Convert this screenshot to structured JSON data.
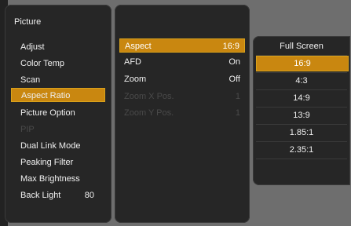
{
  "picture_menu": {
    "title": "Picture",
    "items": [
      {
        "label": "Adjust",
        "value": ""
      },
      {
        "label": "Color Temp",
        "value": ""
      },
      {
        "label": "Scan",
        "value": ""
      },
      {
        "label": "Aspect Ratio",
        "value": ""
      },
      {
        "label": "Picture Option",
        "value": ""
      },
      {
        "label": "PIP",
        "value": ""
      },
      {
        "label": "Dual Link Mode",
        "value": ""
      },
      {
        "label": "Peaking Filter",
        "value": ""
      },
      {
        "label": "Max Brightness",
        "value": ""
      },
      {
        "label": "Back Light",
        "value": "80"
      }
    ]
  },
  "aspect_menu": {
    "items": [
      {
        "label": "Aspect",
        "value": "16:9"
      },
      {
        "label": "AFD",
        "value": "On"
      },
      {
        "label": "Zoom",
        "value": "Off"
      },
      {
        "label": "Zoom X Pos.",
        "value": "1"
      },
      {
        "label": "Zoom Y Pos.",
        "value": "1"
      }
    ]
  },
  "aspect_options": {
    "items": [
      "Full Screen",
      "16:9",
      "4:3",
      "14:9",
      "13:9",
      "1.85:1",
      "2.35:1"
    ],
    "selected": "16:9"
  },
  "colors": {
    "highlight": "#c98710",
    "highlight_border": "#d9a21b",
    "panel": "#262626",
    "disabled_text": "#4a4a4a"
  }
}
